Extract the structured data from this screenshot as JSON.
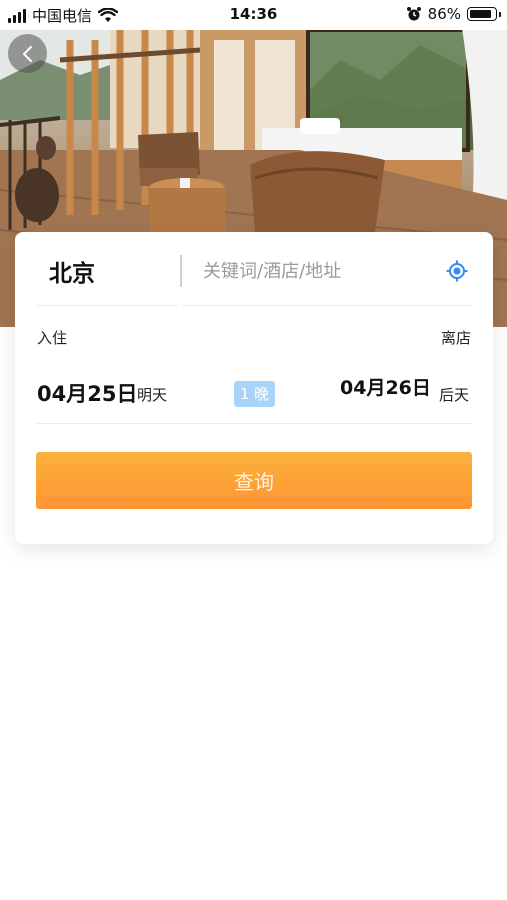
{
  "status_bar": {
    "carrier": "中国电信",
    "time": "14:36",
    "battery_text": "86%",
    "battery_level": 0.86
  },
  "icons": {
    "back": "chevron-left-icon",
    "location": "locate-icon",
    "wifi": "wifi-icon",
    "alarm": "alarm-icon"
  },
  "search": {
    "city": "北京",
    "placeholder": "关键词/酒店/地址"
  },
  "dates": {
    "checkin_label": "入住",
    "checkout_label": "离店",
    "checkin_date": "04月25日",
    "checkin_day": "明天",
    "nights": "1 晚",
    "checkout_date": "04月26日",
    "checkout_day": "后天"
  },
  "actions": {
    "query_label": "查询"
  },
  "colors": {
    "accent_orange": "#ff9433",
    "nights_badge": "#a9d3f7",
    "location_blue": "#2d8ef5"
  }
}
